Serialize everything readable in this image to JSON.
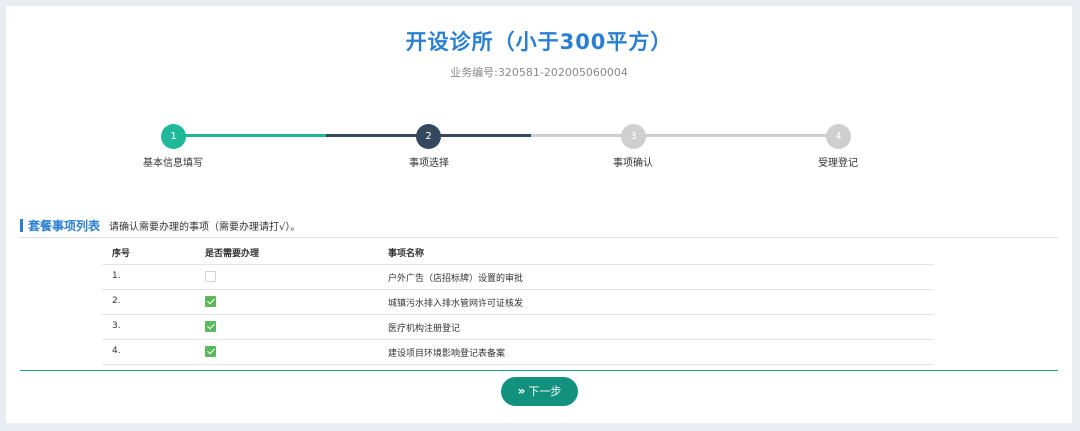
{
  "header": {
    "title": "开设诊所（小于300平方）",
    "business_no": "业务编号:320581-202005060004"
  },
  "steps": [
    {
      "num": "1",
      "label": "基本信息填写",
      "state": "done"
    },
    {
      "num": "2",
      "label": "事项选择",
      "state": "current"
    },
    {
      "num": "3",
      "label": "事项确认",
      "state": "todo"
    },
    {
      "num": "4",
      "label": "受理登记",
      "state": "todo"
    }
  ],
  "section": {
    "title": "套餐事项列表",
    "note": "请确认需要办理的事项（需要办理请打√）。"
  },
  "table": {
    "headers": [
      "序号",
      "是否需要办理",
      "事项名称"
    ],
    "rows": [
      {
        "no": "1.",
        "checked": false,
        "name": "户外广告（店招标牌）设置的审批"
      },
      {
        "no": "2.",
        "checked": true,
        "name": "城镇污水排入排水管网许可证核发"
      },
      {
        "no": "3.",
        "checked": true,
        "name": "医疗机构注册登记"
      },
      {
        "no": "4.",
        "checked": true,
        "name": "建设项目环境影响登记表备案"
      }
    ]
  },
  "footer": {
    "next_label": "下一步",
    "next_icon": "double-chevron-right-icon"
  },
  "colors": {
    "accent_blue": "#2b7fd3",
    "step_done": "#1fb89a",
    "step_current": "#34495e",
    "step_todo": "#cfcfcf",
    "button_teal": "#13917f",
    "checkbox_green": "#5cb85c",
    "background": "#e9ecf1"
  }
}
